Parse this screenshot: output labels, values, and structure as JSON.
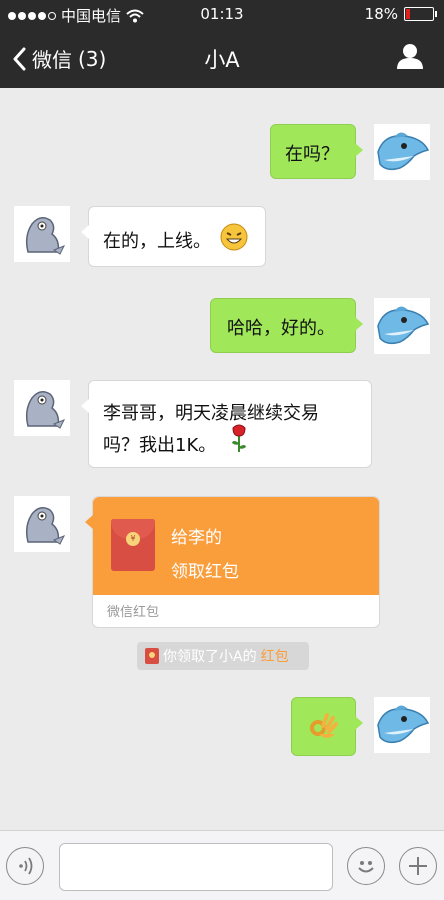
{
  "status_bar": {
    "carrier": "中国电信",
    "time": "01:13",
    "battery_percent": "18%",
    "battery_level": 0.18
  },
  "nav": {
    "back_label": "微信",
    "unread_count": "(3)",
    "title": "小A"
  },
  "messages": [
    {
      "from": "me",
      "text": "在吗？"
    },
    {
      "from": "other",
      "text": "在的，上线。",
      "emoji": "grin-emoji-icon"
    },
    {
      "from": "me",
      "text": "哈哈，好的。"
    },
    {
      "from": "other",
      "line1": "李哥哥，明天凌晨继续交易",
      "line2": "吗？我出1K。",
      "emoji": "rose-icon"
    },
    {
      "from": "other",
      "type": "red-packet",
      "greeting": "给李的",
      "action": "领取红包",
      "footer": "微信红包"
    },
    {
      "type": "system",
      "text_prefix": "你领取了小A的",
      "highlight": "红包"
    },
    {
      "from": "me",
      "emoji": "ok-hand-icon"
    }
  ],
  "colors": {
    "bar_bg": "#2b2b2b",
    "chat_bg": "#ebebeb",
    "my_bubble": "#a0e75a",
    "red_packet": "#fa9d3b",
    "battery_low": "#e0211b"
  },
  "input": {
    "value": "",
    "placeholder": ""
  }
}
